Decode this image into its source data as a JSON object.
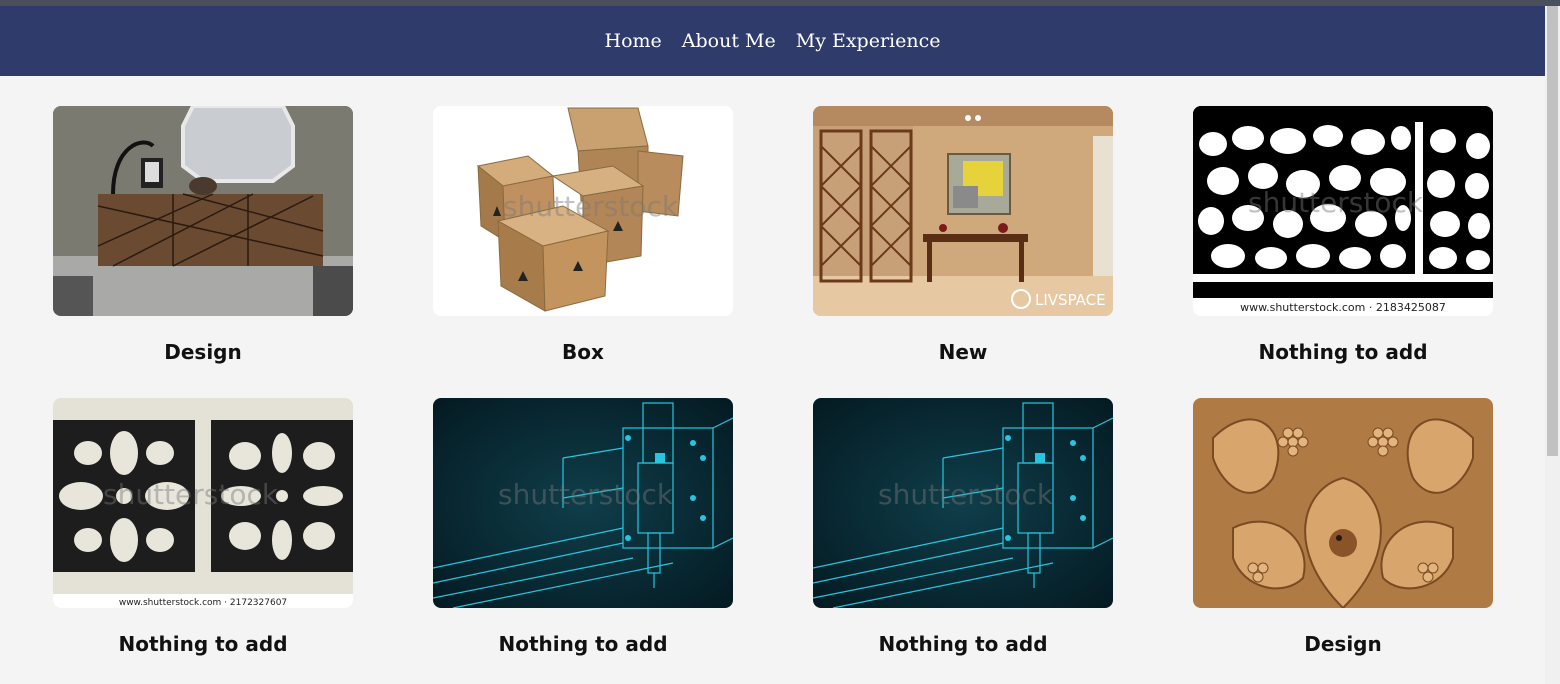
{
  "nav": {
    "items": [
      "Home",
      "About Me",
      "My Experience"
    ]
  },
  "gallery": {
    "cards": [
      {
        "caption": "Design",
        "image": "wooden-sideboard-mirror"
      },
      {
        "caption": "Box",
        "image": "cardboard-boxes",
        "watermark": "shutterstock"
      },
      {
        "caption": "New",
        "image": "living-room-jali-partition",
        "watermark": "LIVSPACE"
      },
      {
        "caption": "Nothing to add",
        "image": "voronoi-pattern-panel",
        "watermark": "shutterstock",
        "footer": "www.shutterstock.com · 2183425087"
      },
      {
        "caption": "Nothing to add",
        "image": "ornamental-tile-pattern",
        "watermark": "shutterstock",
        "footer": "www.shutterstock.com · 2172327607"
      },
      {
        "caption": "Nothing to add",
        "image": "cnc-machine-blueprint",
        "watermark": "shutterstock"
      },
      {
        "caption": "Nothing to add",
        "image": "cnc-machine-blueprint",
        "watermark": "shutterstock"
      },
      {
        "caption": "Design",
        "image": "wood-carving-birds-grapes"
      }
    ]
  },
  "colors": {
    "navbar": "#2f3c6b",
    "background": "#f4f4f4"
  }
}
